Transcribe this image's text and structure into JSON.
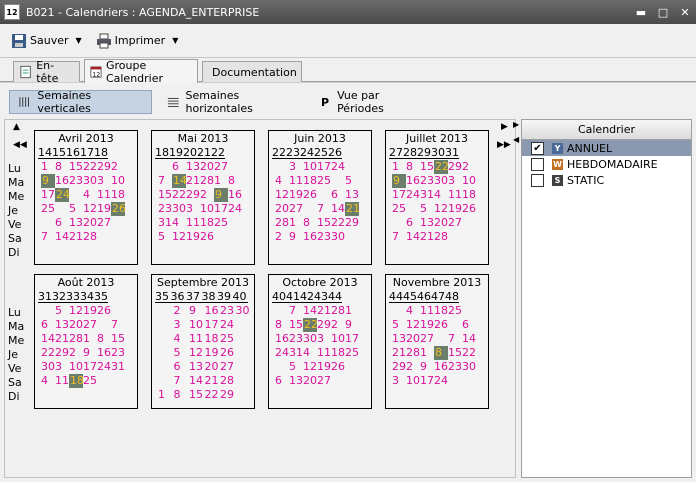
{
  "window": {
    "title": "B021 - Calendriers : AGENDA_ENTERPRISE",
    "icon_text": "12"
  },
  "toolbar": {
    "save_label": "Sauver",
    "print_label": "Imprimer"
  },
  "tabs": [
    {
      "label": "En-tête",
      "icon": "document-icon"
    },
    {
      "label": "Groupe Calendrier",
      "icon": "calendar-icon"
    },
    {
      "label": "Documentation",
      "icon": "book-icon"
    }
  ],
  "views": {
    "vertical": "Semaines verticales",
    "horizontal": "Semaines horizontales",
    "periods_letter": "P",
    "periods": "Vue par Périodes"
  },
  "days": [
    "Lu",
    "Ma",
    "Me",
    "Je",
    "Ve",
    "Sa",
    "Di"
  ],
  "months": [
    {
      "title": "Avril 2013",
      "weeks": [
        "14",
        "15",
        "16",
        "17",
        "18"
      ],
      "rows": [
        [
          "1",
          "8",
          "15",
          "22",
          "29"
        ],
        [
          "2",
          "9",
          "16",
          "23",
          "30"
        ],
        [
          "3",
          "10",
          "17",
          "24",
          ""
        ],
        [
          "4",
          "11",
          "18",
          "25",
          ""
        ],
        [
          "5",
          "12",
          "19",
          "26",
          ""
        ],
        [
          "6",
          "13",
          "20",
          "27",
          ""
        ],
        [
          "7",
          "14",
          "21",
          "28",
          ""
        ]
      ],
      "hl": [
        "9",
        "24",
        "26"
      ]
    },
    {
      "title": "Mai 2013",
      "weeks": [
        "18",
        "19",
        "20",
        "21",
        "22"
      ],
      "rows": [
        [
          "",
          "6",
          "13",
          "20",
          "27"
        ],
        [
          "",
          "7",
          "14",
          "21",
          "28"
        ],
        [
          "1",
          "8",
          "15",
          "22",
          "29"
        ],
        [
          "2",
          "9",
          "16",
          "23",
          "30"
        ],
        [
          "3",
          "10",
          "17",
          "24",
          "31"
        ],
        [
          "4",
          "11",
          "18",
          "25",
          ""
        ],
        [
          "5",
          "12",
          "19",
          "26",
          ""
        ]
      ],
      "hl": [
        "14",
        "9"
      ]
    },
    {
      "title": "Juin 2013",
      "weeks": [
        "22",
        "23",
        "24",
        "25",
        "26"
      ],
      "rows": [
        [
          "",
          "3",
          "10",
          "17",
          "24"
        ],
        [
          "",
          "4",
          "11",
          "18",
          "25"
        ],
        [
          "",
          "5",
          "12",
          "19",
          "26"
        ],
        [
          "",
          "6",
          "13",
          "20",
          "27"
        ],
        [
          "",
          "7",
          "14",
          "21",
          "28"
        ],
        [
          "1",
          "8",
          "15",
          "22",
          "29"
        ],
        [
          "2",
          "9",
          "16",
          "23",
          "30"
        ]
      ],
      "hl": [
        "21"
      ]
    },
    {
      "title": "Juillet 2013",
      "weeks": [
        "27",
        "28",
        "29",
        "30",
        "31"
      ],
      "rows": [
        [
          "1",
          "8",
          "15",
          "22",
          "29"
        ],
        [
          "2",
          "9",
          "16",
          "23",
          "30"
        ],
        [
          "3",
          "10",
          "17",
          "24",
          "31"
        ],
        [
          "4",
          "11",
          "18",
          "25",
          ""
        ],
        [
          "5",
          "12",
          "19",
          "26",
          ""
        ],
        [
          "6",
          "13",
          "20",
          "27",
          ""
        ],
        [
          "7",
          "14",
          "21",
          "28",
          ""
        ]
      ],
      "hl": [
        "22",
        "9"
      ]
    },
    {
      "title": "Août 2013",
      "weeks": [
        "31",
        "32",
        "33",
        "34",
        "35"
      ],
      "rows": [
        [
          "",
          "5",
          "12",
          "19",
          "26"
        ],
        [
          "",
          "6",
          "13",
          "20",
          "27"
        ],
        [
          "",
          "7",
          "14",
          "21",
          "28"
        ],
        [
          "1",
          "8",
          "15",
          "22",
          "29"
        ],
        [
          "2",
          "9",
          "16",
          "23",
          "30"
        ],
        [
          "3",
          "10",
          "17",
          "24",
          "31"
        ],
        [
          "4",
          "11",
          "18",
          "25",
          ""
        ]
      ],
      "hl": [
        "18"
      ]
    },
    {
      "title": "Septembre 2013",
      "weeks": [
        "35",
        "36",
        "37",
        "38",
        "39",
        "40"
      ],
      "rows": [
        [
          "",
          "2",
          "9",
          "16",
          "23",
          "30"
        ],
        [
          "",
          "3",
          "10",
          "17",
          "24",
          ""
        ],
        [
          "",
          "4",
          "11",
          "18",
          "25",
          ""
        ],
        [
          "",
          "5",
          "12",
          "19",
          "26",
          ""
        ],
        [
          "",
          "6",
          "13",
          "20",
          "27",
          ""
        ],
        [
          "",
          "7",
          "14",
          "21",
          "28",
          ""
        ],
        [
          "1",
          "8",
          "15",
          "22",
          "29",
          ""
        ]
      ],
      "hl": []
    },
    {
      "title": "Octobre 2013",
      "weeks": [
        "40",
        "41",
        "42",
        "43",
        "44"
      ],
      "rows": [
        [
          "",
          "7",
          "14",
          "21",
          "28"
        ],
        [
          "1",
          "8",
          "15",
          "22",
          "29"
        ],
        [
          "2",
          "9",
          "16",
          "23",
          "30"
        ],
        [
          "3",
          "10",
          "17",
          "24",
          "31"
        ],
        [
          "4",
          "11",
          "18",
          "25",
          ""
        ],
        [
          "5",
          "12",
          "19",
          "26",
          ""
        ],
        [
          "6",
          "13",
          "20",
          "27",
          ""
        ]
      ],
      "hl": [
        "22"
      ]
    },
    {
      "title": "Novembre 2013",
      "weeks": [
        "44",
        "45",
        "46",
        "47",
        "48"
      ],
      "rows": [
        [
          "",
          "4",
          "11",
          "18",
          "25"
        ],
        [
          "",
          "5",
          "12",
          "19",
          "26"
        ],
        [
          "",
          "6",
          "13",
          "20",
          "27"
        ],
        [
          "",
          "7",
          "14",
          "21",
          "28"
        ],
        [
          "1",
          "8",
          "15",
          "22",
          "29"
        ],
        [
          "2",
          "9",
          "16",
          "23",
          "30"
        ],
        [
          "3",
          "10",
          "17",
          "24",
          ""
        ]
      ],
      "hl": [
        "8"
      ]
    }
  ],
  "calendar_panel": {
    "header": "Calendrier",
    "items": [
      {
        "label": "ANNUEL",
        "checked": true,
        "icon_letter": "Y",
        "icon_color": "#4a6a9a",
        "selected": true
      },
      {
        "label": "HEBDOMADAIRE",
        "checked": false,
        "icon_letter": "W",
        "icon_color": "#c07020",
        "selected": false
      },
      {
        "label": "STATIC",
        "checked": false,
        "icon_letter": "S",
        "icon_color": "#404040",
        "selected": false
      }
    ]
  }
}
